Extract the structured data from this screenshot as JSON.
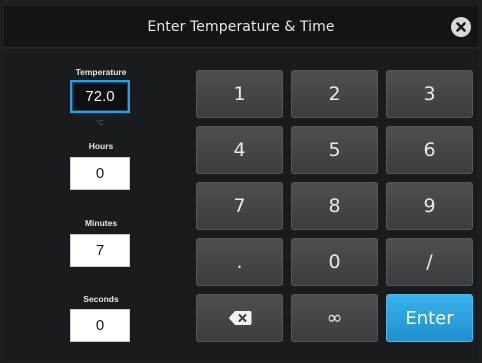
{
  "dialog": {
    "title": "Enter Temperature & Time",
    "close_icon": "close-circle-icon"
  },
  "fields": {
    "temperature": {
      "label": "Temperature",
      "value": "72.0",
      "unit": "°C"
    },
    "hours": {
      "label": "Hours",
      "value": "0"
    },
    "minutes": {
      "label": "Minutes",
      "value": "7"
    },
    "seconds": {
      "label": "Seconds",
      "value": "0"
    }
  },
  "keypad": {
    "k1": "1",
    "k2": "2",
    "k3": "3",
    "k4": "4",
    "k5": "5",
    "k6": "6",
    "k7": "7",
    "k8": "8",
    "k9": "9",
    "dot": ".",
    "k0": "0",
    "slash": "/",
    "backspace_icon": "backspace-icon",
    "infinity": "∞",
    "enter": "Enter"
  },
  "colors": {
    "accent": "#2b9fe0",
    "enter_button": "#2aa3e0",
    "key_background": "#444648",
    "background": "#1a1b1c"
  }
}
